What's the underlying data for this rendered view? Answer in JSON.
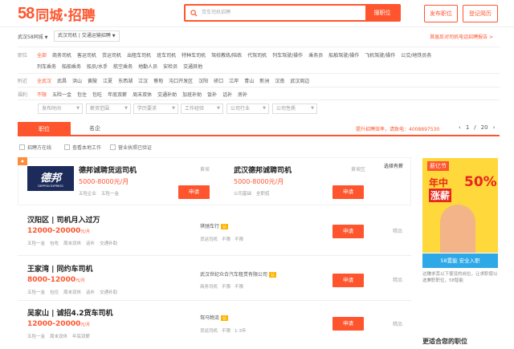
{
  "header": {
    "logo_num": "58",
    "logo_text": "同城·招聘",
    "search_placeholder": "货车司机招聘",
    "search_button": "搜职位",
    "post_job": "发布职位",
    "post_resume": "登记简历"
  },
  "location": {
    "city": "武汉58同城",
    "breadcrumb": "武汉司机 | 交通运输招聘",
    "report": "首届反对司机电话招聘报告 >"
  },
  "filters": {
    "job_label": "职位",
    "job_options": [
      "全部",
      "商务司机",
      "客运司机",
      "货运司机",
      "出租车司机",
      "班车司机",
      "特种车司机",
      "驾校教练/陪练",
      "代驾司机",
      "列车驾驶/操作",
      "乘务员",
      "船舶驾驶/操作",
      "飞机驾驶/操作",
      "公交/地铁员务"
    ],
    "job_options2": [
      "列车乘务",
      "船舶乘务",
      "船员/水手",
      "航空乘务",
      "地勤人员",
      "安检员",
      "交通其他"
    ],
    "area_label": "附近",
    "area_options": [
      "全武汉",
      "武昌",
      "洪山",
      "黄陂",
      "江夏",
      "东西湖",
      "江汉",
      "蔡甸",
      "沌口开发区",
      "汉阳",
      "硚口",
      "江岸",
      "青山",
      "新洲",
      "汉南",
      "武汉周边"
    ],
    "benefit_label": "福利",
    "benefit_options": [
      "不限",
      "五险一金",
      "包住",
      "包吃",
      "年底双薪",
      "周末双休",
      "交通补助",
      "加班补助",
      "饭补",
      "话补",
      "房补"
    ],
    "dropdowns": [
      "发布时间",
      "薪资范围",
      "学历要求",
      "工作经验",
      "公司行业",
      "公司性质"
    ]
  },
  "tabs": {
    "jobs": "职位",
    "company": "名企"
  },
  "promo": "提升招聘效率，请致电：4008897530",
  "pager": {
    "current": "1",
    "total": "20",
    "separator": "/"
  },
  "checkboxes": [
    "招聘方在线",
    "查看本地工作",
    "营业执照已验证"
  ],
  "listings": [
    {
      "title": "德邦诚聘货运司机",
      "salary": "5000-8000元/月",
      "tags": [
        "五险企业",
        "五险一金"
      ],
      "location": "黄坡",
      "apply": "申请",
      "logo": "德邦",
      "logo_sub": "DEPPON EXPRESS"
    },
    {
      "title": "武汉德邦诚聘司机",
      "salary": "5000-8000元/月",
      "tags": [
        "公司基础",
        "全职招"
      ],
      "location": "黄坡区",
      "apply": "申请",
      "flag": "选择有薪"
    },
    {
      "title": "汉阳区 | 司机月入过万",
      "salary": "12000-20000",
      "salary_unit": "元/月",
      "tags": [
        "五险一金",
        "包吃",
        "周末双休",
        "话补",
        "交通补助"
      ],
      "company": "祺驰车行",
      "badge": "认",
      "company_tags": [
        "货运司机",
        "不限",
        "不限"
      ],
      "apply": "申请",
      "date": "精品"
    },
    {
      "title": "王家湾 | 同约车司机",
      "salary": "8000-12000",
      "salary_unit": "元/月",
      "tags": [
        "五险一金",
        "包住",
        "周末双休",
        "话补",
        "交通补助"
      ],
      "company": "武汉世纪众合汽车租赁有限公司",
      "badge": "认",
      "company_tags": [
        "商务司机",
        "不限",
        "不限"
      ],
      "apply": "申请",
      "date": "精品"
    },
    {
      "title": "吴家山 | 诚招4.2货车司机",
      "salary": "12000-20000",
      "salary_unit": "元/月",
      "tags": [
        "五险一金",
        "周末双休",
        "年底双薪"
      ],
      "company": "驾马物流",
      "badge": "认",
      "company_tags": [
        "货运司机",
        "不限",
        "1-3年"
      ],
      "apply": "申请",
      "date": "精品"
    }
  ],
  "ad": {
    "line1": "薪亿节",
    "line2": "年中",
    "line3": "涨薪",
    "pct": "50%",
    "bar": "58置能 安全入职",
    "desc": "边赚求其以下使没的岗位，让求职使以选兼职职位，58智能"
  },
  "sidebar_more": "更适合您的职位",
  "colors": {
    "accent": "#ff552e",
    "badge": "#ffb400",
    "ad_yellow": "#ffd83b",
    "ad_blue": "#2fa8e7"
  }
}
